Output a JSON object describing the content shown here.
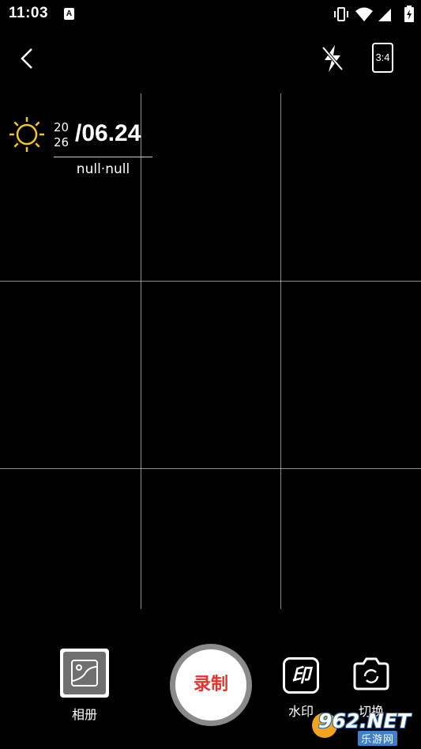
{
  "status_bar": {
    "time": "11:03",
    "notification_badge": "A"
  },
  "topbar": {
    "aspect_ratio": "3:4"
  },
  "watermark": {
    "year_top": "20",
    "year_bottom": "26",
    "date": "/06.24",
    "location": "null·null",
    "sun_color": "#f2c81a"
  },
  "bottom_bar": {
    "album_label": "相册",
    "record_label": "录制",
    "watermark_button": "印",
    "watermark_label": "水印",
    "switch_label": "切换",
    "record_color": "#e5322d"
  },
  "site_logo": {
    "main": "962.NET",
    "sub": "乐游网"
  }
}
